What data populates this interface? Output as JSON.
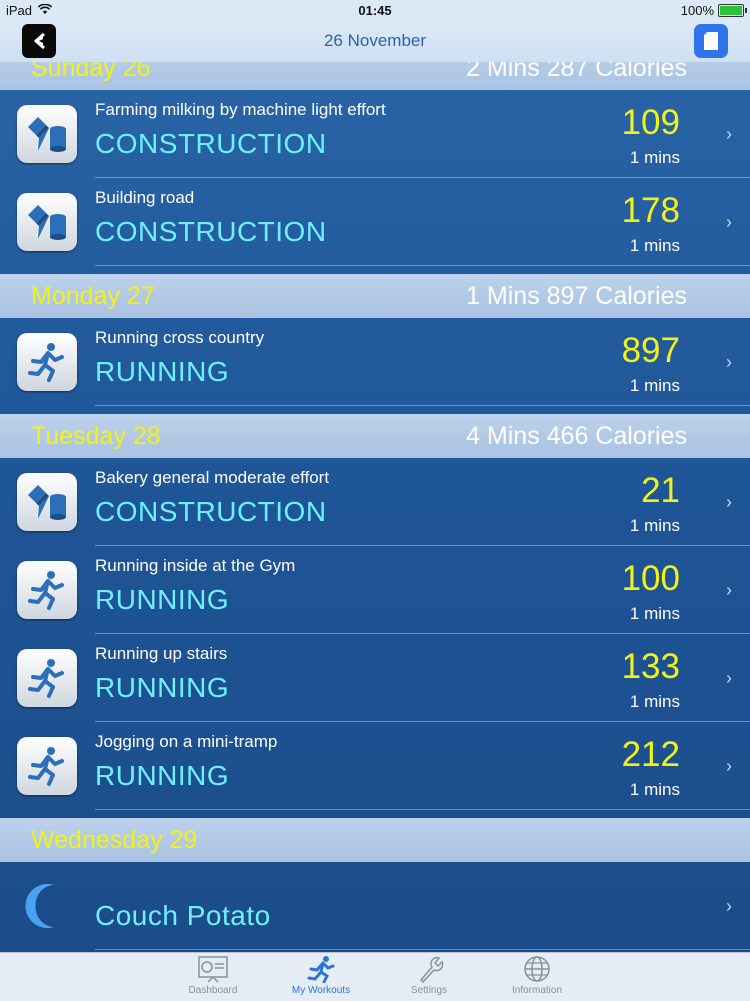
{
  "status": {
    "device": "iPad",
    "time": "01:45",
    "battery": "100%"
  },
  "nav": {
    "title": "26 November"
  },
  "sections": [
    {
      "day": "Sunday 26",
      "summary": "2 Mins 287 Calories",
      "rows": [
        {
          "name": "Farming milking by machine light effort",
          "category": "CONSTRUCTION",
          "calories": "109",
          "mins": "1 mins",
          "icon": "construction-icon"
        },
        {
          "name": "Building road",
          "category": "CONSTRUCTION",
          "calories": "178",
          "mins": "1 mins",
          "icon": "construction-icon"
        }
      ]
    },
    {
      "day": "Monday 27",
      "summary": "1 Mins 897 Calories",
      "rows": [
        {
          "name": "Running cross country",
          "category": "RUNNING",
          "calories": "897",
          "mins": "1 mins",
          "icon": "running-icon"
        }
      ]
    },
    {
      "day": "Tuesday 28",
      "summary": "4 Mins 466 Calories",
      "rows": [
        {
          "name": "Bakery general moderate effort",
          "category": "CONSTRUCTION",
          "calories": "21",
          "mins": "1 mins",
          "icon": "construction-icon"
        },
        {
          "name": "Running inside at the Gym",
          "category": "RUNNING",
          "calories": "100",
          "mins": "1 mins",
          "icon": "running-icon"
        },
        {
          "name": "Running up stairs",
          "category": "RUNNING",
          "calories": "133",
          "mins": "1 mins",
          "icon": "running-icon"
        },
        {
          "name": "Jogging on a mini-tramp",
          "category": "RUNNING",
          "calories": "212",
          "mins": "1 mins",
          "icon": "running-icon"
        }
      ]
    },
    {
      "day": "Wednesday 29",
      "summary": "",
      "rows": [
        {
          "name": "",
          "category": "Couch Potato",
          "calories": "",
          "mins": "",
          "icon": "moon-icon"
        }
      ]
    }
  ],
  "tabs": [
    {
      "label": "Dashboard",
      "icon": "dashboard-icon",
      "active": false
    },
    {
      "label": "My Workouts",
      "icon": "runner-tab-icon",
      "active": true
    },
    {
      "label": "Settings",
      "icon": "wrench-icon",
      "active": false
    },
    {
      "label": "Information",
      "icon": "globe-icon",
      "active": false
    }
  ],
  "colors": {
    "accent_yellow": "#f2f219",
    "category_cyan": "#6ef0ff",
    "tab_active": "#2d74d8"
  }
}
